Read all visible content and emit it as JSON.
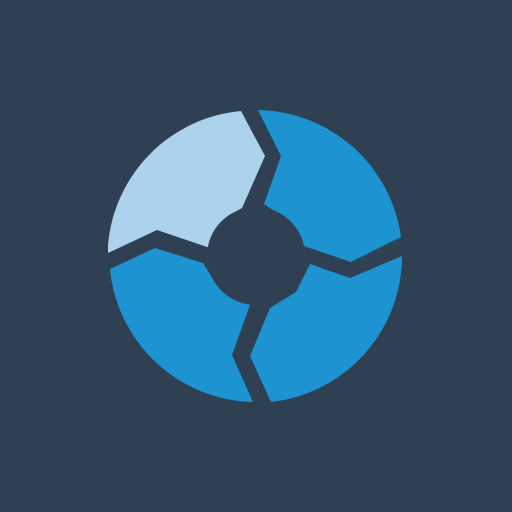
{
  "icon": {
    "name": "segmented-ring-icon",
    "colors": {
      "background": "#2f4053",
      "segment_light": "#acd2ee",
      "segment_blue": "#1d93d2",
      "hub": "#2f4053"
    },
    "segments": [
      {
        "name": "top-left",
        "color_key": "segment_light"
      },
      {
        "name": "top-right",
        "color_key": "segment_blue"
      },
      {
        "name": "bottom-left",
        "color_key": "segment_blue"
      },
      {
        "name": "bottom-right",
        "color_key": "segment_blue"
      }
    ]
  }
}
